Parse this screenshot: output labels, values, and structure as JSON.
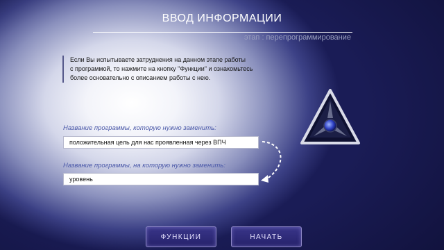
{
  "header": {
    "title": "ВВОД ИНФОРМАЦИИ",
    "stage": "этап : перепрограммирование"
  },
  "info_text": [
    "Если Вы испытываете затруднения на данном этапе работы",
    "с программой, то нажмите на кнопку \"Функции\" и ознакомьтесь",
    "более основательно с описанием работы с нею."
  ],
  "form": {
    "replace_label": "Название программы, которую нужно заменить:",
    "replace_value": "положительная цель  для нас проявленная через  ВПЧ",
    "new_label": "Название программы, на которую нужно заменить:",
    "new_value": "уровень"
  },
  "buttons": {
    "functions": "ФУНКЦИИ",
    "start": "НАЧАТЬ"
  },
  "colors": {
    "background": "#14164a",
    "label_blue": "#4a58a8",
    "button": "#2e2a7a"
  },
  "icons": {
    "emblem": "triangle-emblem-icon",
    "arrow": "curved-arrow-icon"
  }
}
